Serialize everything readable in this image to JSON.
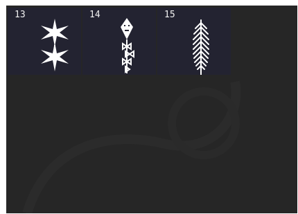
{
  "stitch_tiles": [
    {
      "number": "13",
      "icon": "star-stitch-icon"
    },
    {
      "number": "14",
      "icon": "kite-bow-stitch-icon"
    },
    {
      "number": "15",
      "icon": "feather-stitch-icon"
    }
  ]
}
